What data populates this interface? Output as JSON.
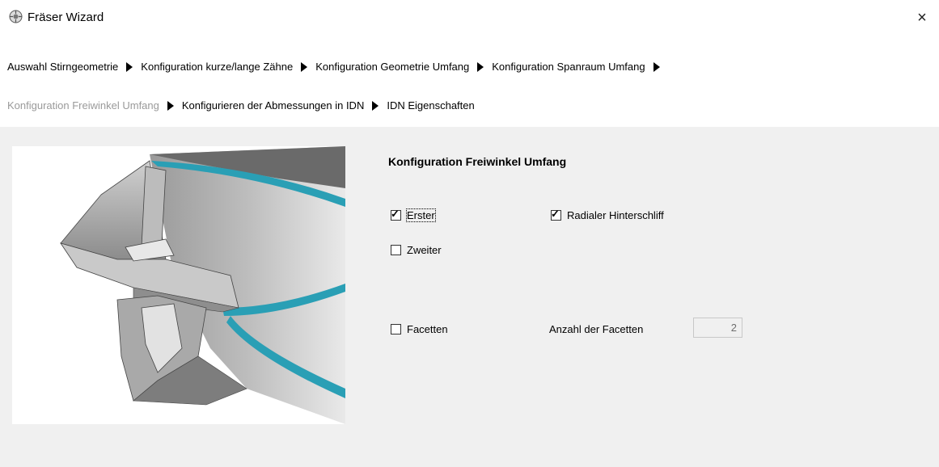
{
  "window": {
    "title": "Fräser Wizard",
    "app_icon": "cog-globe-icon",
    "close_glyph": "×"
  },
  "breadcrumb": {
    "row1": [
      "Auswahl Stirngeometrie",
      "Konfiguration kurze/lange Zähne",
      "Konfiguration Geometrie Umfang",
      "Konfiguration Spanraum Umfang"
    ],
    "row2": [
      "Konfiguration Freiwinkel Umfang",
      "Konfigurieren der Abmessungen in IDN",
      "IDN Eigenschaften"
    ],
    "current": "Konfiguration Freiwinkel Umfang"
  },
  "section": {
    "title": "Konfiguration Freiwinkel Umfang"
  },
  "options": {
    "erster": {
      "label": "Erster",
      "checked": true
    },
    "radialer": {
      "label": "Radialer Hinterschliff",
      "checked": true
    },
    "zweiter": {
      "label": "Zweiter",
      "checked": false
    },
    "facetten": {
      "label": "Facetten",
      "checked": false
    }
  },
  "facets": {
    "label": "Anzahl der Facetten",
    "value": "2"
  },
  "colors": {
    "dialog_bg": "#f0f0f0",
    "current_step": "#9a9a9a",
    "accent_teal": "#2a9fb5"
  }
}
